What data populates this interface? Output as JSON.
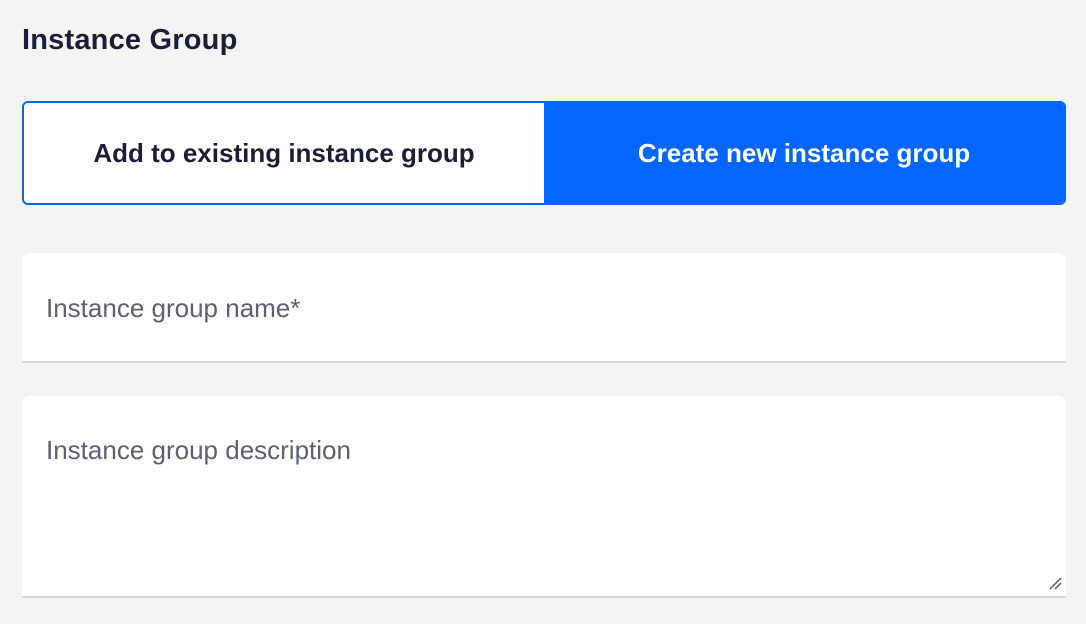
{
  "section": {
    "title": "Instance Group"
  },
  "mode_toggle": {
    "options": [
      {
        "label": "Add to existing instance group",
        "selected": false
      },
      {
        "label": "Create new instance group",
        "selected": true
      }
    ]
  },
  "form": {
    "name_field": {
      "placeholder": "Instance group name*",
      "value": ""
    },
    "description_field": {
      "placeholder": "Instance group description",
      "value": ""
    }
  },
  "colors": {
    "accent": "#0066ff",
    "background": "#f4f4f4",
    "text_primary": "#1a1f36",
    "placeholder": "#5c6270"
  }
}
